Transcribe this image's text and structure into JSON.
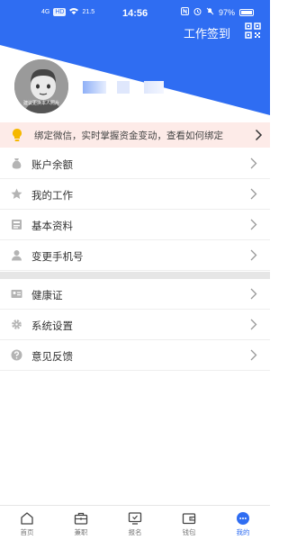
{
  "status_bar": {
    "time": "14:56",
    "network": "4G",
    "hd": "HD",
    "speed": "21.5",
    "battery": "97%"
  },
  "header": {
    "sign_in_label": "工作签到",
    "avatar_caption": "建议更换本人照片"
  },
  "notice": {
    "text": "绑定微信，实时掌握资金变动，查看如何绑定"
  },
  "menu_group1": [
    {
      "label": "账户余额",
      "icon": "money-bag-icon"
    },
    {
      "label": "我的工作",
      "icon": "star-icon"
    },
    {
      "label": "基本资料",
      "icon": "profile-card-icon"
    },
    {
      "label": "变更手机号",
      "icon": "user-icon"
    }
  ],
  "menu_group2": [
    {
      "label": "健康证",
      "icon": "id-card-icon"
    },
    {
      "label": "系统设置",
      "icon": "gear-icon"
    },
    {
      "label": "意见反馈",
      "icon": "question-icon"
    }
  ],
  "bottom_nav": [
    {
      "label": "首页",
      "icon": "home-icon"
    },
    {
      "label": "兼职",
      "icon": "briefcase-icon"
    },
    {
      "label": "报名",
      "icon": "monitor-icon"
    },
    {
      "label": "钱包",
      "icon": "wallet-icon"
    },
    {
      "label": "我的",
      "icon": "chat-bubble-icon",
      "active": true
    }
  ],
  "colors": {
    "brand_blue": "#2f6df2",
    "notice_bg": "#fdebe8",
    "icon_gray": "#b4b4b4"
  }
}
